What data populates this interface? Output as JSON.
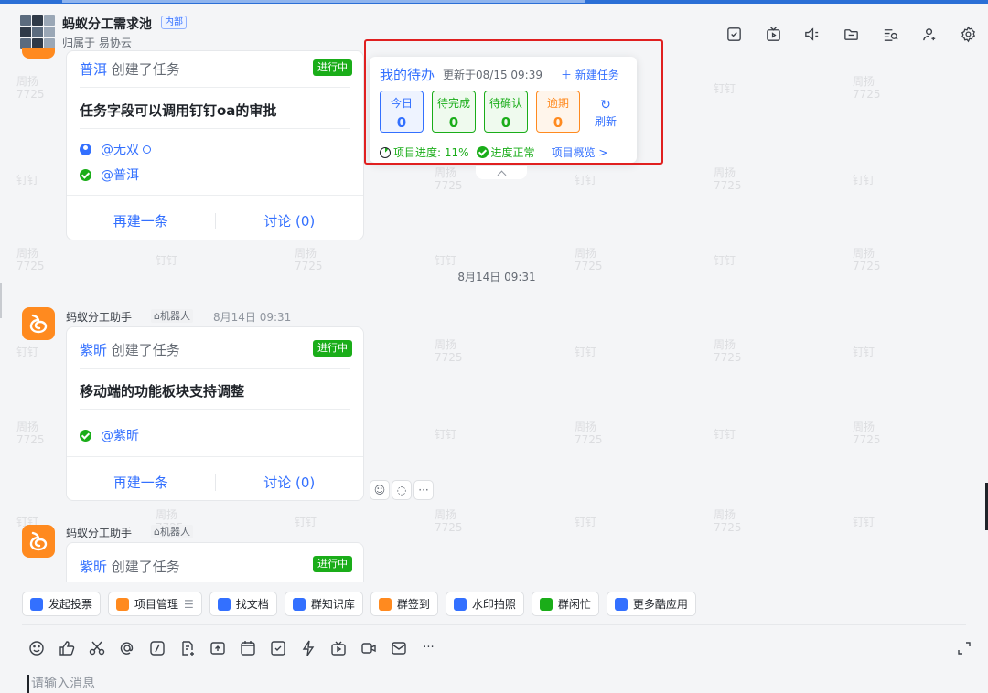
{
  "header": {
    "group_name": "蚂蚁分工需求池",
    "group_tag": "内部",
    "subtitle": "归属于 易协云"
  },
  "header_icons": [
    "task-check-icon",
    "live-tv-icon",
    "announce-icon",
    "folder-icon",
    "search-list-icon",
    "add-member-icon",
    "settings-gear-icon"
  ],
  "watermark": {
    "name": "周扬",
    "id": "7725",
    "app": "钉钉"
  },
  "card1": {
    "author": "普洱",
    "action": "创建了任务",
    "status": "进行中",
    "title": "任务字段可以调用钉钉oa的审批",
    "assignee1": "@无双",
    "assignee2": "@普洱",
    "action_redo": "再建一条",
    "action_discuss": "讨论 (0)"
  },
  "timestamp": "8月14日 09:31",
  "msg2": {
    "sender": "蚂蚁分工助手",
    "robot": "机器人",
    "time": "8月14日 09:31"
  },
  "card2": {
    "author": "紫昕",
    "action": "创建了任务",
    "status": "进行中",
    "title": "移动端的功能板块支持调整",
    "assignee1": "@紫昕",
    "action_redo": "再建一条",
    "action_discuss": "讨论 (0)"
  },
  "reactions": {
    "more": "···"
  },
  "msg3": {
    "sender": "蚂蚁分工助手",
    "robot": "机器人"
  },
  "card3": {
    "author": "紫昕",
    "action": "创建了任务",
    "status": "进行中"
  },
  "todo_popup": {
    "title": "我的待办",
    "updated": "更新于08/15 09:39",
    "new_task": "新建任务",
    "stats": [
      {
        "label": "今日",
        "value": "0",
        "color": "#3370ff",
        "bg": "#eef3ff"
      },
      {
        "label": "待完成",
        "value": "0",
        "color": "#1aad19",
        "bg": "#effaee"
      },
      {
        "label": "待确认",
        "value": "0",
        "color": "#1aad19",
        "bg": "#effaee"
      },
      {
        "label": "逾期",
        "value": "0",
        "color": "#ff8a1f",
        "bg": "#fff5eb"
      }
    ],
    "refresh": "刷新",
    "progress_label": "项目进度:",
    "progress_value": "11%",
    "progress_fraction": 0.11,
    "status_text": "进度正常",
    "overview": "项目概览 >"
  },
  "apps": [
    {
      "label": "发起投票",
      "color": "#3370ff"
    },
    {
      "label": "项目管理",
      "color": "#ff8a1f",
      "more": "☰"
    },
    {
      "label": "找文档",
      "color": "#3370ff"
    },
    {
      "label": "群知识库",
      "color": "#3370ff"
    },
    {
      "label": "群签到",
      "color": "#ff8a1f"
    },
    {
      "label": "水印拍照",
      "color": "#3370ff"
    },
    {
      "label": "群闲忙",
      "color": "#1aad19"
    },
    {
      "label": "更多酷应用",
      "color": "#3370ff"
    }
  ],
  "toolbar_icons": [
    "emoji-icon",
    "thumbs-up-icon",
    "scissors-icon",
    "at-icon",
    "slash-command-icon",
    "file-plus-icon",
    "upload-icon",
    "calendar-icon",
    "task-check-icon",
    "lightning-icon",
    "live-tv-icon",
    "video-icon",
    "mail-icon",
    "more-icon"
  ],
  "composer": {
    "placeholder": "请输入消息",
    "more": "···"
  }
}
